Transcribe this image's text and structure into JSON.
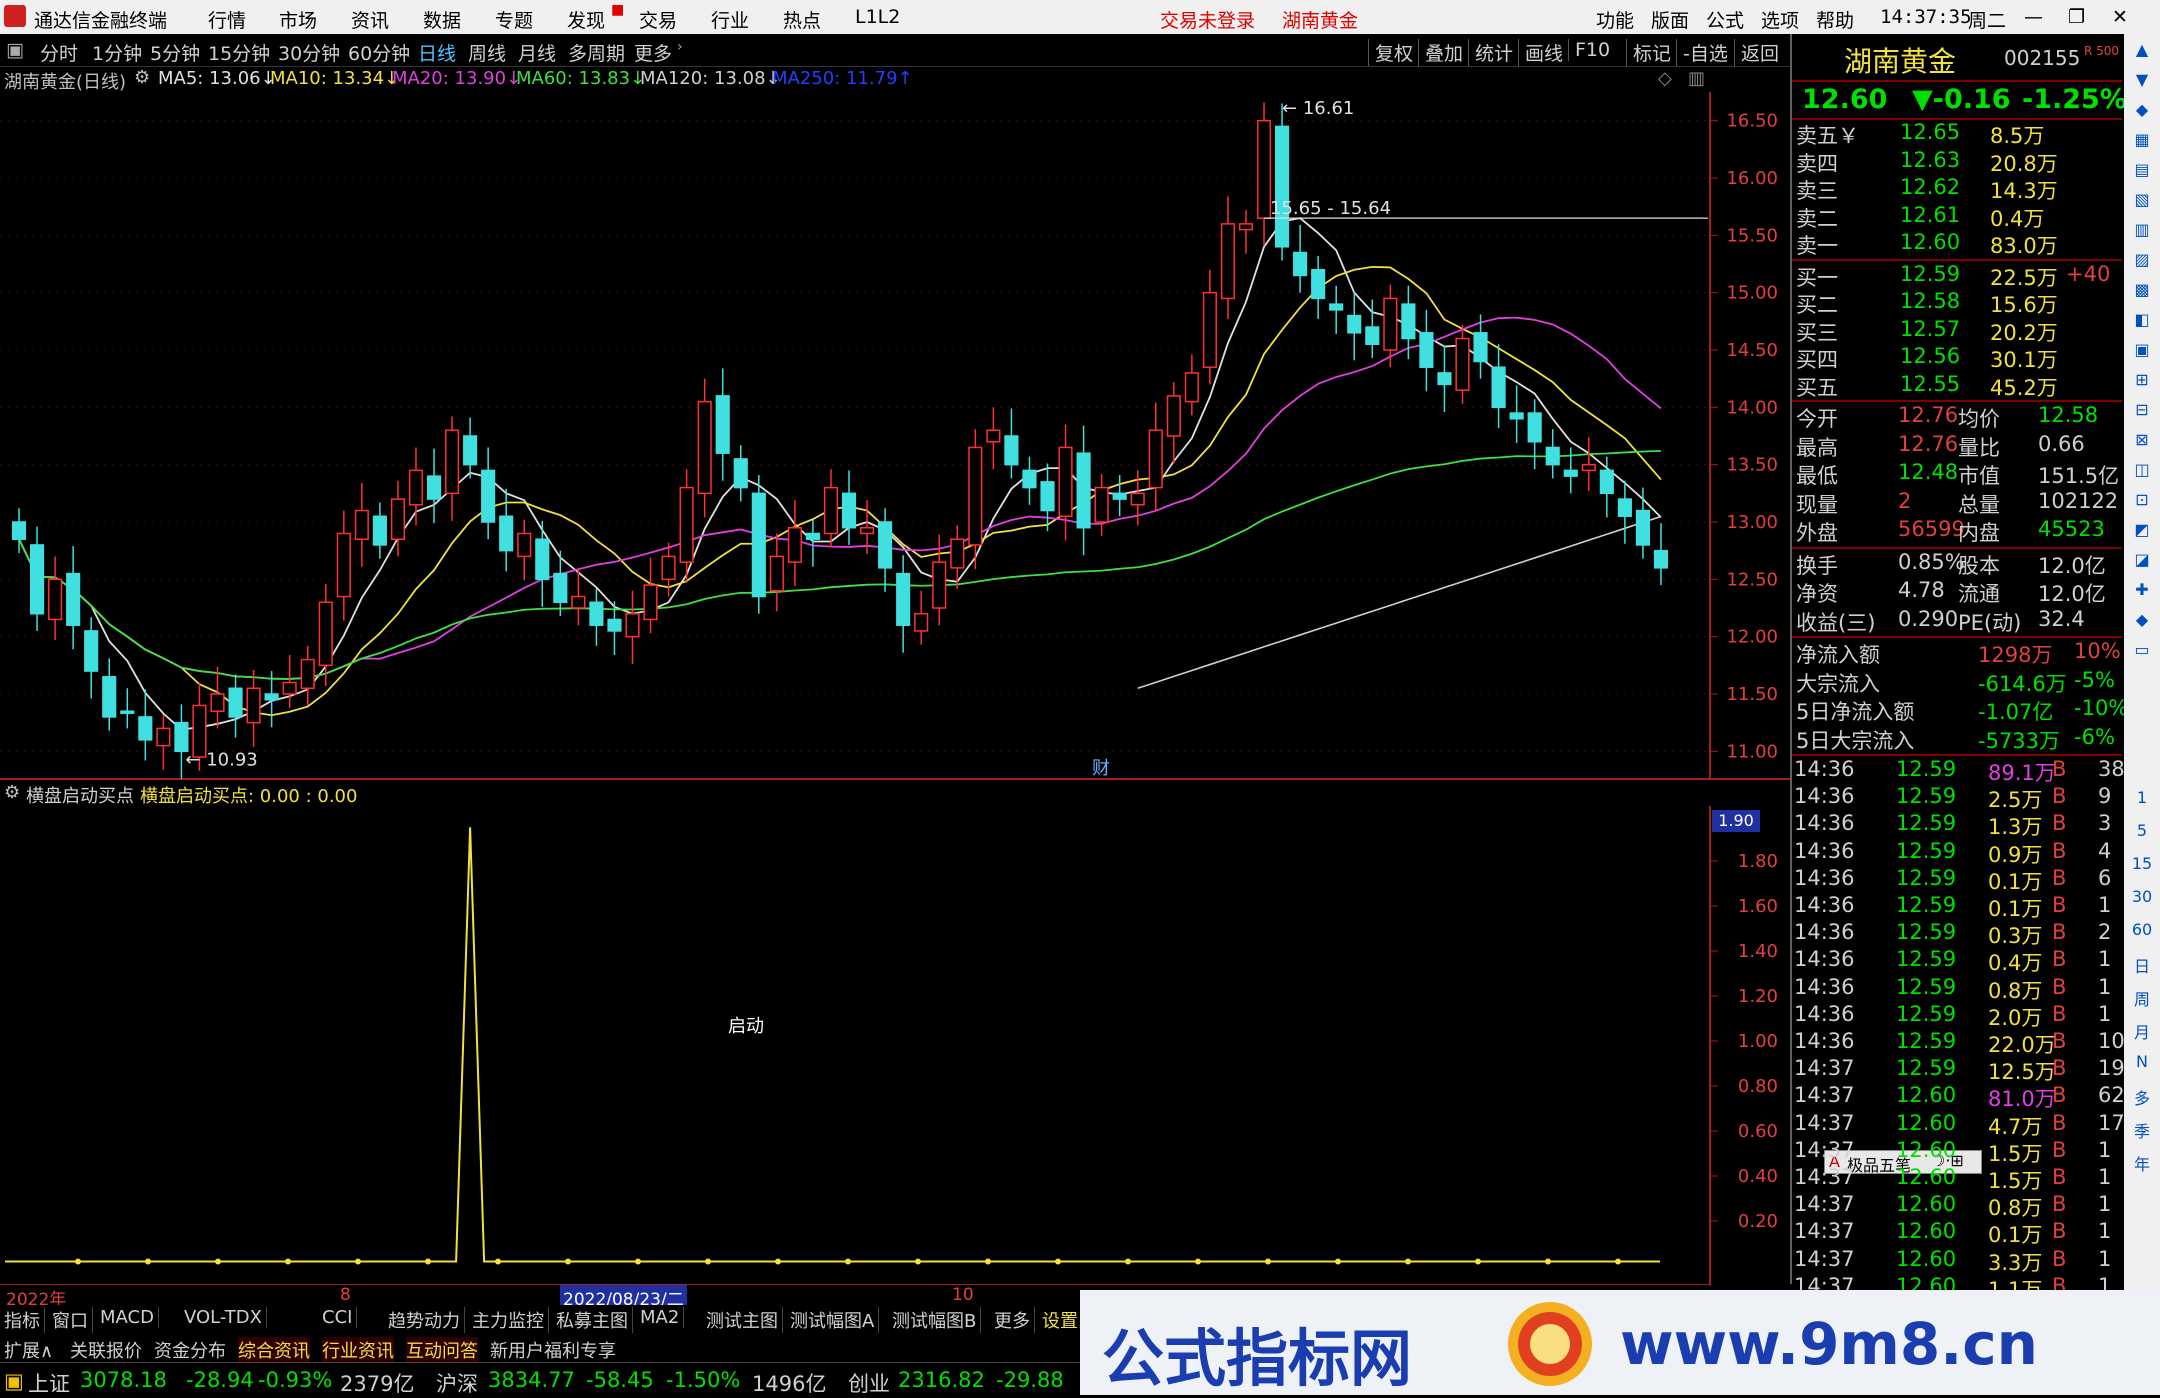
{
  "menu": {
    "app_title": "通达信金融终端",
    "items": [
      "行情",
      "市场",
      "资讯",
      "数据",
      "专题",
      "发现",
      "交易",
      "行业",
      "热点",
      "L1L2"
    ],
    "status_login": "交易未登录",
    "status_stock": "湖南黄金",
    "right_items": [
      "功能",
      "版面",
      "公式",
      "选项",
      "帮助"
    ],
    "clock": "14:37:35",
    "weekday": "周二"
  },
  "toolbar": {
    "periods": [
      "分时",
      "1分钟",
      "5分钟",
      "15分钟",
      "30分钟",
      "60分钟",
      "日线",
      "周线",
      "月线",
      "多周期",
      "更多"
    ],
    "active_period": "日线",
    "right_buttons": [
      "复权",
      "叠加",
      "统计",
      "画线",
      "F10",
      "标记",
      "-自选",
      "返回"
    ]
  },
  "main_chart": {
    "title": "湖南黄金(日线)",
    "ma": [
      {
        "label": "MA5: 13.06↓",
        "color": "#e0e0e0"
      },
      {
        "label": "MA10: 13.34↓",
        "color": "#f0e040"
      },
      {
        "label": "MA20: 13.90↓",
        "color": "#e040e0"
      },
      {
        "label": "MA60: 13.83↓",
        "color": "#40e040"
      },
      {
        "label": "MA120: 13.08↓",
        "color": "#d0d0d0"
      },
      {
        "label": "MA250: 11.79↑",
        "color": "#2040ff"
      }
    ],
    "y_ticks": [
      "16.50",
      "16.00",
      "15.50",
      "15.00",
      "14.50",
      "14.00",
      "13.50",
      "13.00",
      "12.50",
      "12.00",
      "11.50",
      "11.00"
    ],
    "annotations": {
      "high": "16.61",
      "low": "10.93",
      "hline": "15.65 - 15.64",
      "event": "财"
    }
  },
  "chart_data": {
    "type": "candlestick",
    "y_range": [
      10.75,
      16.75
    ],
    "candles_close": [
      12.85,
      12.2,
      12.5,
      12.1,
      11.7,
      11.3,
      11.35,
      11.1,
      11.2,
      11.0,
      11.4,
      11.5,
      11.3,
      11.55,
      11.45,
      11.6,
      11.8,
      12.3,
      12.9,
      13.1,
      12.8,
      13.2,
      13.45,
      13.2,
      13.8,
      13.5,
      13.0,
      12.75,
      12.9,
      12.5,
      12.3,
      12.35,
      12.1,
      12.05,
      12.2,
      12.45,
      12.7,
      13.3,
      14.05,
      13.6,
      13.3,
      12.35,
      12.7,
      12.95,
      12.85,
      13.3,
      12.95,
      12.95,
      12.6,
      12.1,
      12.2,
      12.65,
      12.85,
      13.65,
      13.8,
      13.5,
      13.3,
      13.1,
      13.65,
      12.95,
      13.3,
      13.2,
      13.25,
      13.8,
      14.1,
      14.3,
      15.0,
      15.6,
      15.6,
      16.5,
      15.4,
      15.15,
      14.95,
      14.85,
      14.65,
      14.55,
      14.95,
      14.6,
      14.35,
      14.2,
      14.6,
      14.4,
      14.0,
      13.9,
      13.7,
      13.5,
      13.4,
      13.5,
      13.25,
      13.05,
      12.8,
      12.6
    ]
  },
  "indicator": {
    "header": "横盘启动买点",
    "header_value": "横盘启动买点: 0.00 : 0.00",
    "y_ticks": [
      "1.80",
      "1.60",
      "1.40",
      "1.20",
      "1.00",
      "0.80",
      "0.60",
      "0.40",
      "0.20"
    ],
    "current": "1.90",
    "signal_label": "启动"
  },
  "x_axis": {
    "labels": [
      "2022年",
      "8",
      "2022/08/23/二",
      "10"
    ]
  },
  "quote": {
    "name": "湖南黄金",
    "code": "002155",
    "tag": "R 500",
    "price": "12.60",
    "change": "▼-0.16",
    "change_pct": "-1.25%",
    "asks": [
      {
        "label": "卖五￥",
        "price": "12.65",
        "vol": "8.5万"
      },
      {
        "label": "卖四",
        "price": "12.63",
        "vol": "20.8万"
      },
      {
        "label": "卖三",
        "price": "12.62",
        "vol": "14.3万"
      },
      {
        "label": "卖二",
        "price": "12.61",
        "vol": "0.4万"
      },
      {
        "label": "卖一",
        "price": "12.60",
        "vol": "83.0万"
      }
    ],
    "bids": [
      {
        "label": "买一",
        "price": "12.59",
        "vol": "22.5万",
        "extra": "+40"
      },
      {
        "label": "买二",
        "price": "12.58",
        "vol": "15.6万",
        "extra": ""
      },
      {
        "label": "买三",
        "price": "12.57",
        "vol": "20.2万",
        "extra": ""
      },
      {
        "label": "买四",
        "price": "12.56",
        "vol": "30.1万",
        "extra": ""
      },
      {
        "label": "买五",
        "price": "12.55",
        "vol": "45.2万",
        "extra": ""
      }
    ],
    "stats": [
      {
        "l1": "今开",
        "v1": "12.76",
        "l2": "均价",
        "v2": "12.58"
      },
      {
        "l1": "最高",
        "v1": "12.76",
        "l2": "量比",
        "v2": "0.66"
      },
      {
        "l1": "最低",
        "v1": "12.48",
        "l2": "市值",
        "v2": "151.5亿"
      },
      {
        "l1": "现量",
        "v1": "2",
        "l2": "总量",
        "v2": "102122"
      },
      {
        "l1": "外盘",
        "v1": "56599",
        "l2": "内盘",
        "v2": "45523"
      }
    ],
    "stats2": [
      {
        "l1": "换手",
        "v1": "0.85%",
        "l2": "股本",
        "v2": "12.0亿"
      },
      {
        "l1": "净资",
        "v1": "4.78",
        "l2": "流通",
        "v2": "12.0亿"
      },
      {
        "l1": "收益(三)",
        "v1": "0.290",
        "l2": "PE(动)",
        "v2": "32.4"
      }
    ],
    "flows": [
      {
        "label": "净流入额",
        "value": "1298万",
        "pct": "10%"
      },
      {
        "label": "大宗流入",
        "value": "-614.6万",
        "pct": "-5%"
      },
      {
        "label": "5日净流入额",
        "value": "-1.07亿",
        "pct": "-10%"
      },
      {
        "label": "5日大宗流入",
        "value": "-5733万",
        "pct": "-6%"
      }
    ],
    "ticks": [
      {
        "t": "14:36",
        "p": "12.59",
        "v": "89.1万",
        "s": "B",
        "n": "38"
      },
      {
        "t": "14:36",
        "p": "12.59",
        "v": "2.5万",
        "s": "B",
        "n": "9"
      },
      {
        "t": "14:36",
        "p": "12.59",
        "v": "1.3万",
        "s": "B",
        "n": "3"
      },
      {
        "t": "14:36",
        "p": "12.59",
        "v": "0.9万",
        "s": "B",
        "n": "4"
      },
      {
        "t": "14:36",
        "p": "12.59",
        "v": "0.1万",
        "s": "B",
        "n": "6"
      },
      {
        "t": "14:36",
        "p": "12.59",
        "v": "0.1万",
        "s": "B",
        "n": "1"
      },
      {
        "t": "14:36",
        "p": "12.59",
        "v": "0.3万",
        "s": "B",
        "n": "2"
      },
      {
        "t": "14:36",
        "p": "12.59",
        "v": "0.4万",
        "s": "B",
        "n": "1"
      },
      {
        "t": "14:36",
        "p": "12.59",
        "v": "0.8万",
        "s": "B",
        "n": "1"
      },
      {
        "t": "14:36",
        "p": "12.59",
        "v": "2.0万",
        "s": "B",
        "n": "1"
      },
      {
        "t": "14:36",
        "p": "12.59",
        "v": "22.0万",
        "s": "B",
        "n": "10"
      },
      {
        "t": "14:37",
        "p": "12.59",
        "v": "12.5万",
        "s": "B",
        "n": "19"
      },
      {
        "t": "14:37",
        "p": "12.60",
        "v": "81.0万",
        "s": "B",
        "n": "62"
      },
      {
        "t": "14:37",
        "p": "12.60",
        "v": "4.7万",
        "s": "B",
        "n": "17"
      },
      {
        "t": "14:37",
        "p": "12.60",
        "v": "1.5万",
        "s": "B",
        "n": "1"
      },
      {
        "t": "14:37",
        "p": "12.60",
        "v": "1.5万",
        "s": "B",
        "n": "1"
      },
      {
        "t": "14:37",
        "p": "12.60",
        "v": "0.8万",
        "s": "B",
        "n": "1"
      },
      {
        "t": "14:37",
        "p": "12.60",
        "v": "0.1万",
        "s": "B",
        "n": "1"
      },
      {
        "t": "14:37",
        "p": "12.60",
        "v": "3.3万",
        "s": "B",
        "n": "1"
      },
      {
        "t": "14:37",
        "p": "12.60",
        "v": "1.1万",
        "s": "B",
        "n": "1"
      }
    ],
    "popup": "极品五笔"
  },
  "side_strip": [
    "1",
    "5",
    "15",
    "30",
    "60",
    "日",
    "周",
    "月",
    "N",
    "多",
    "季",
    "年"
  ],
  "bottom_tabs": [
    "指标",
    "窗口",
    "MACD",
    "VOL-TDX",
    "CCI",
    "趋势动力",
    "主力监控",
    "私募主图",
    "MA2",
    "测试主图",
    "测试幅图A",
    "测试幅图B",
    "更多",
    "设置"
  ],
  "bottom_tabs2": [
    "扩展∧",
    "关联报价",
    "资金分布",
    "综合资讯",
    "行业资讯",
    "互动问答",
    "新用户福利专享"
  ],
  "status": {
    "sh_label": "上证",
    "sh_val": "3078.18",
    "sh_chg": "-28.94",
    "sh_pct": "-0.93%",
    "sh_amt": "2379亿",
    "hs_label": "沪深",
    "hs_val": "3834.77",
    "hs_chg": "-58.45",
    "hs_pct": "-1.50%",
    "hs_amt": "1496亿",
    "cy_label": "创业",
    "cy_val": "2316.82",
    "cy_chg": "-29.88"
  },
  "watermark": {
    "text": "公式指标网",
    "url": "www.9m8.cn"
  }
}
